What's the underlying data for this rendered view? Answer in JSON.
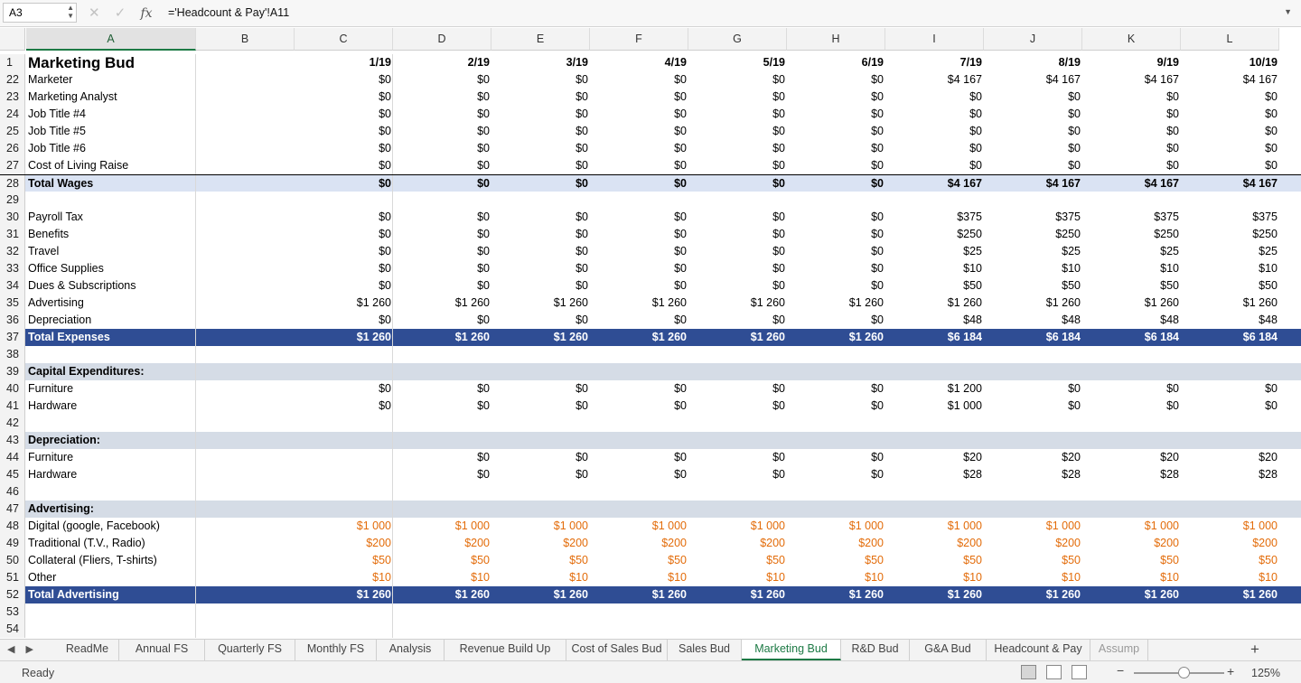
{
  "formula_bar": {
    "name_box": "A3",
    "cancel_icon": "✕",
    "enter_icon": "✓",
    "fx_label": "fx",
    "formula": "='Headcount & Pay'!A11"
  },
  "columns": [
    "A",
    "B",
    "C",
    "D",
    "E",
    "F",
    "G",
    "H",
    "I",
    "J",
    "K",
    "L"
  ],
  "selected_column": "A",
  "rows": [
    {
      "num": "1",
      "label": "Marketing Bud",
      "style": "title",
      "values": [
        "1/19",
        "2/19",
        "3/19",
        "4/19",
        "5/19",
        "6/19",
        "7/19",
        "8/19",
        "9/19",
        "10/19"
      ]
    },
    {
      "num": "22",
      "label": "Marketer",
      "style": "",
      "values": [
        "$0",
        "$0",
        "$0",
        "$0",
        "$0",
        "$0",
        "$4 167",
        "$4 167",
        "$4 167",
        "$4 167"
      ]
    },
    {
      "num": "23",
      "label": "Marketing Analyst",
      "style": "",
      "values": [
        "$0",
        "$0",
        "$0",
        "$0",
        "$0",
        "$0",
        "$0",
        "$0",
        "$0",
        "$0"
      ]
    },
    {
      "num": "24",
      "label": "Job Title #4",
      "style": "",
      "values": [
        "$0",
        "$0",
        "$0",
        "$0",
        "$0",
        "$0",
        "$0",
        "$0",
        "$0",
        "$0"
      ]
    },
    {
      "num": "25",
      "label": "Job Title #5",
      "style": "",
      "values": [
        "$0",
        "$0",
        "$0",
        "$0",
        "$0",
        "$0",
        "$0",
        "$0",
        "$0",
        "$0"
      ]
    },
    {
      "num": "26",
      "label": "Job Title #6",
      "style": "",
      "values": [
        "$0",
        "$0",
        "$0",
        "$0",
        "$0",
        "$0",
        "$0",
        "$0",
        "$0",
        "$0"
      ]
    },
    {
      "num": "27",
      "label": "Cost of Living Raise",
      "style": "",
      "values": [
        "$0",
        "$0",
        "$0",
        "$0",
        "$0",
        "$0",
        "$0",
        "$0",
        "$0",
        "$0"
      ]
    },
    {
      "num": "28",
      "label": "Total Wages",
      "style": "light bold topborder",
      "values": [
        "$0",
        "$0",
        "$0",
        "$0",
        "$0",
        "$0",
        "$4 167",
        "$4 167",
        "$4 167",
        "$4 167"
      ]
    },
    {
      "num": "29",
      "label": "",
      "style": "",
      "values": []
    },
    {
      "num": "30",
      "label": "Payroll Tax",
      "style": "",
      "values": [
        "$0",
        "$0",
        "$0",
        "$0",
        "$0",
        "$0",
        "$375",
        "$375",
        "$375",
        "$375"
      ]
    },
    {
      "num": "31",
      "label": "Benefits",
      "style": "",
      "values": [
        "$0",
        "$0",
        "$0",
        "$0",
        "$0",
        "$0",
        "$250",
        "$250",
        "$250",
        "$250"
      ]
    },
    {
      "num": "32",
      "label": "Travel",
      "style": "",
      "values": [
        "$0",
        "$0",
        "$0",
        "$0",
        "$0",
        "$0",
        "$25",
        "$25",
        "$25",
        "$25"
      ]
    },
    {
      "num": "33",
      "label": "Office Supplies",
      "style": "",
      "values": [
        "$0",
        "$0",
        "$0",
        "$0",
        "$0",
        "$0",
        "$10",
        "$10",
        "$10",
        "$10"
      ]
    },
    {
      "num": "34",
      "label": "Dues & Subscriptions",
      "style": "",
      "values": [
        "$0",
        "$0",
        "$0",
        "$0",
        "$0",
        "$0",
        "$50",
        "$50",
        "$50",
        "$50"
      ]
    },
    {
      "num": "35",
      "label": "Advertising",
      "style": "",
      "values": [
        "$1 260",
        "$1 260",
        "$1 260",
        "$1 260",
        "$1 260",
        "$1 260",
        "$1 260",
        "$1 260",
        "$1 260",
        "$1 260"
      ]
    },
    {
      "num": "36",
      "label": "Depreciation",
      "style": "",
      "values": [
        "$0",
        "$0",
        "$0",
        "$0",
        "$0",
        "$0",
        "$48",
        "$48",
        "$48",
        "$48"
      ]
    },
    {
      "num": "37",
      "label": "Total Expenses",
      "style": "dark bold",
      "values": [
        "$1 260",
        "$1 260",
        "$1 260",
        "$1 260",
        "$1 260",
        "$1 260",
        "$6 184",
        "$6 184",
        "$6 184",
        "$6 184"
      ]
    },
    {
      "num": "38",
      "label": "",
      "style": "",
      "values": []
    },
    {
      "num": "39",
      "label": "Capital Expenditures:",
      "style": "section bold",
      "values": []
    },
    {
      "num": "40",
      "label": "Furniture",
      "style": "",
      "values": [
        "$0",
        "$0",
        "$0",
        "$0",
        "$0",
        "$0",
        "$1 200",
        "$0",
        "$0",
        "$0"
      ]
    },
    {
      "num": "41",
      "label": "Hardware",
      "style": "",
      "values": [
        "$0",
        "$0",
        "$0",
        "$0",
        "$0",
        "$0",
        "$1 000",
        "$0",
        "$0",
        "$0"
      ]
    },
    {
      "num": "42",
      "label": "",
      "style": "",
      "values": []
    },
    {
      "num": "43",
      "label": "Depreciation:",
      "style": "section bold",
      "values": []
    },
    {
      "num": "44",
      "label": "Furniture",
      "style": "",
      "values": [
        "",
        "$0",
        "$0",
        "$0",
        "$0",
        "$0",
        "$20",
        "$20",
        "$20",
        "$20"
      ]
    },
    {
      "num": "45",
      "label": "Hardware",
      "style": "",
      "values": [
        "",
        "$0",
        "$0",
        "$0",
        "$0",
        "$0",
        "$28",
        "$28",
        "$28",
        "$28"
      ]
    },
    {
      "num": "46",
      "label": "",
      "style": "",
      "values": []
    },
    {
      "num": "47",
      "label": "Advertising:",
      "style": "section bold",
      "values": []
    },
    {
      "num": "48",
      "label": "Digital (google, Facebook)",
      "style": "orange",
      "values": [
        "$1 000",
        "$1 000",
        "$1 000",
        "$1 000",
        "$1 000",
        "$1 000",
        "$1 000",
        "$1 000",
        "$1 000",
        "$1 000"
      ]
    },
    {
      "num": "49",
      "label": "Traditional (T.V., Radio)",
      "style": "orange",
      "values": [
        "$200",
        "$200",
        "$200",
        "$200",
        "$200",
        "$200",
        "$200",
        "$200",
        "$200",
        "$200"
      ]
    },
    {
      "num": "50",
      "label": "Collateral (Fliers, T-shirts)",
      "style": "orange",
      "values": [
        "$50",
        "$50",
        "$50",
        "$50",
        "$50",
        "$50",
        "$50",
        "$50",
        "$50",
        "$50"
      ]
    },
    {
      "num": "51",
      "label": "Other",
      "style": "orange",
      "values": [
        "$10",
        "$10",
        "$10",
        "$10",
        "$10",
        "$10",
        "$10",
        "$10",
        "$10",
        "$10"
      ]
    },
    {
      "num": "52",
      "label": "Total Advertising",
      "style": "dark bold",
      "values": [
        "$1 260",
        "$1 260",
        "$1 260",
        "$1 260",
        "$1 260",
        "$1 260",
        "$1 260",
        "$1 260",
        "$1 260",
        "$1 260"
      ]
    },
    {
      "num": "53",
      "label": "",
      "style": "",
      "values": []
    },
    {
      "num": "54",
      "label": "",
      "style": "",
      "values": []
    }
  ],
  "sheet_tabs": [
    "ReadMe",
    "Annual FS",
    "Quarterly FS",
    "Monthly FS",
    "Analysis",
    "Revenue Build Up",
    "Cost of Sales Bud",
    "Sales Bud",
    "Marketing Bud",
    "R&D Bud",
    "G&A Bud",
    "Headcount & Pay",
    "Assump"
  ],
  "active_tab": "Marketing Bud",
  "add_sheet": "+",
  "status": {
    "ready": "Ready",
    "zoom_minus": "−",
    "zoom_plus": "+",
    "zoom": "125%",
    "zoom_level": 125
  },
  "colors": {
    "accent": "#1d7a45",
    "total_row": "#2f4d94",
    "subtotal_row": "#dae3f3",
    "section_row": "#d5dce6",
    "input_values": "#e36c0a"
  }
}
